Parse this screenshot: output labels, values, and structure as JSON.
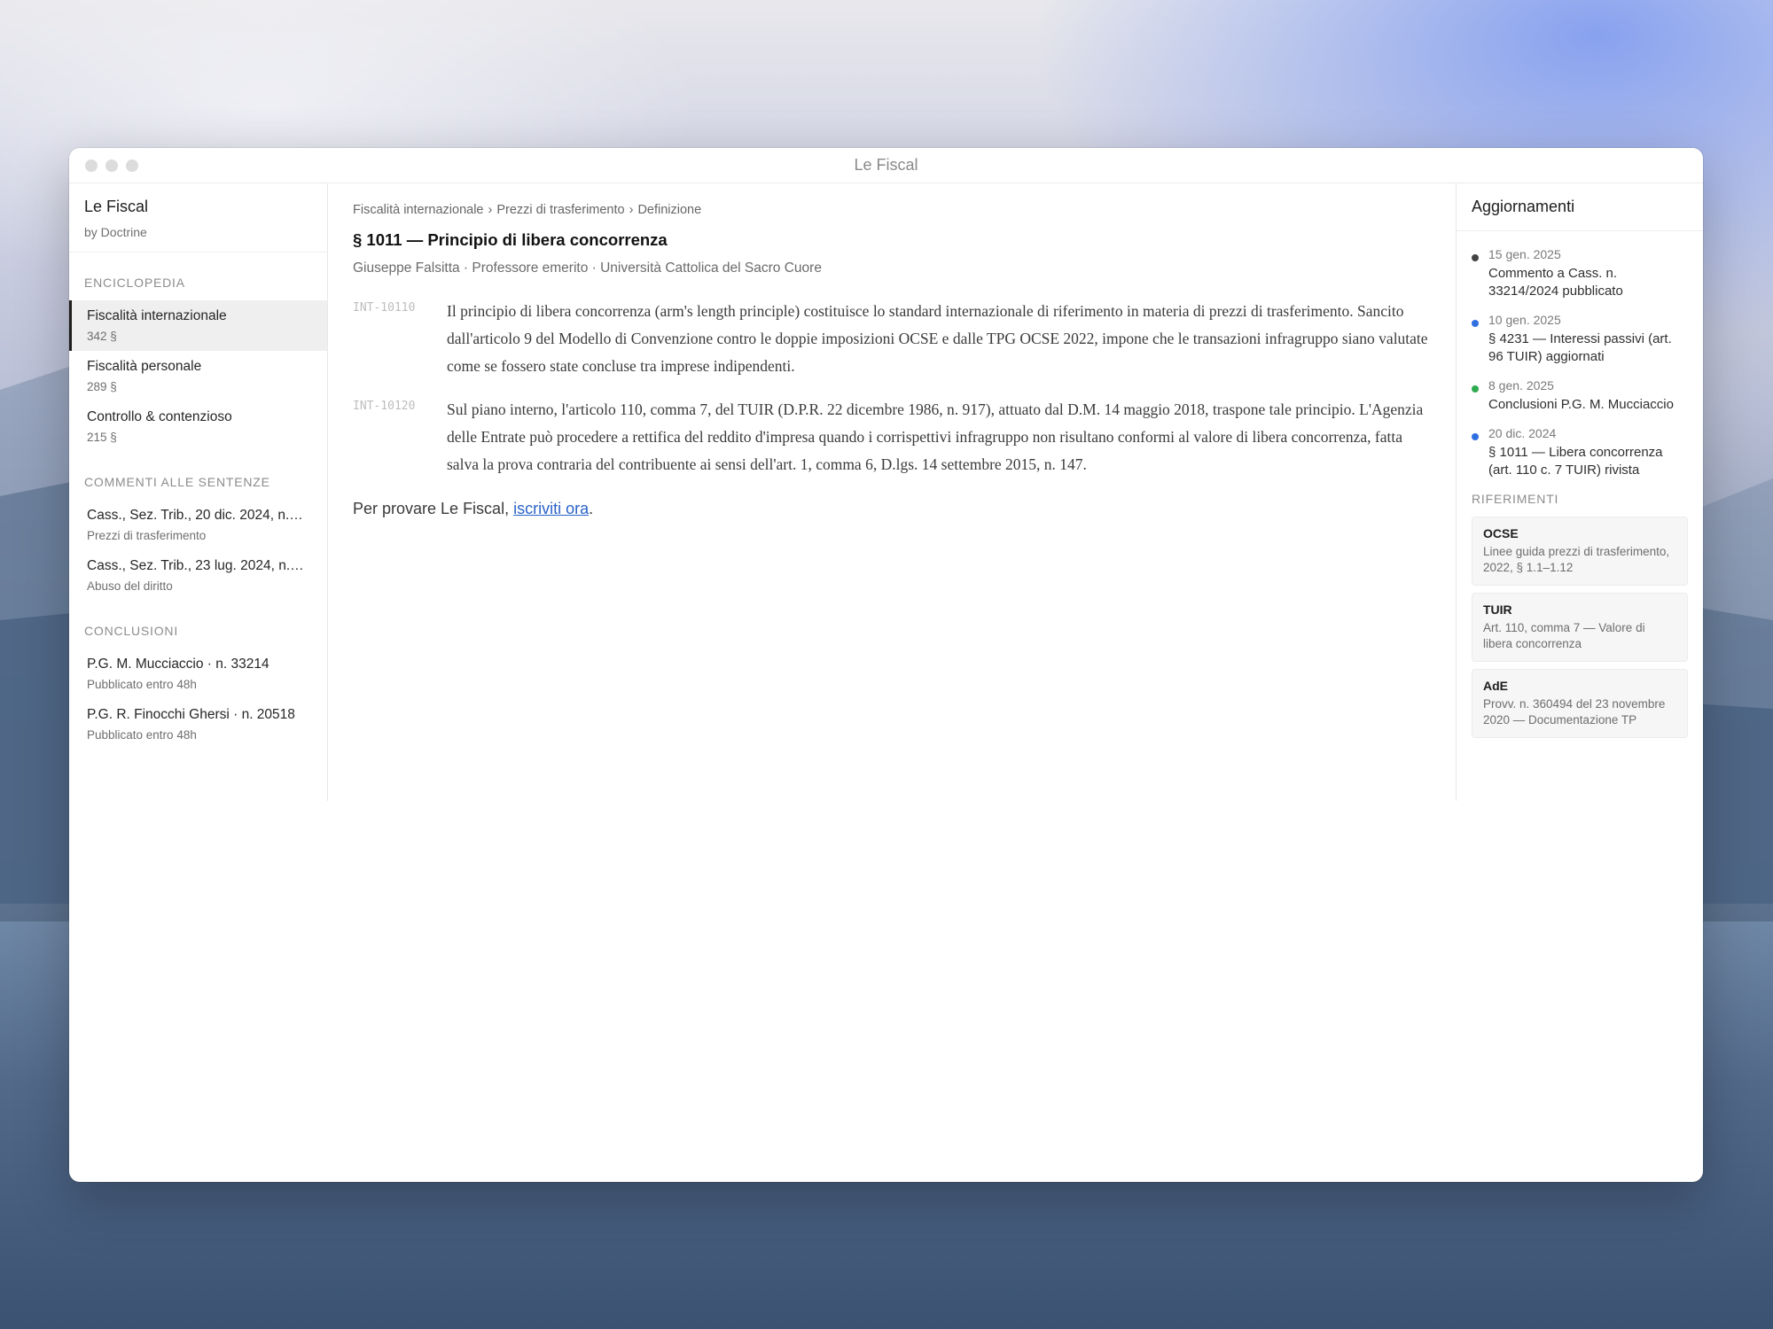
{
  "window": {
    "title": "Le Fiscal"
  },
  "sidebar": {
    "brand_title": "Le Fiscal",
    "brand_sub": "by Doctrine",
    "sections": [
      {
        "heading": "ENCICLOPEDIA",
        "items": [
          {
            "label": "Fiscalità internazionale",
            "meta": "342 §",
            "active": true
          },
          {
            "label": "Fiscalità personale",
            "meta": "289 §"
          },
          {
            "label": "Controllo & contenzioso",
            "meta": "215 §"
          }
        ]
      },
      {
        "heading": "COMMENTI ALLE SENTENZE",
        "items": [
          {
            "label": "Cass., Sez. Trib., 20 dic. 2024, n.…",
            "meta": "Prezzi di trasferimento"
          },
          {
            "label": "Cass., Sez. Trib., 23 lug. 2024, n.…",
            "meta": "Abuso del diritto"
          }
        ]
      },
      {
        "heading": "CONCLUSIONI",
        "items": [
          {
            "label": "P.G. M. Mucciaccio · n. 33214",
            "meta": "Pubblicato entro 48h"
          },
          {
            "label": "P.G. R. Finocchi Ghersi · n. 20518",
            "meta": "Pubblicato entro 48h"
          }
        ]
      }
    ]
  },
  "main": {
    "breadcrumb": [
      "Fiscalità internazionale",
      "Prezzi di trasferimento",
      "Definizione"
    ],
    "breadcrumb_sep": "›",
    "title": "§ 1011 — Principio di libera concorrenza",
    "author": "Giuseppe Falsitta · Professore emerito · Università Cattolica del Sacro Cuore",
    "paragraphs": [
      {
        "id": "INT-10110",
        "text": "Il principio di libera concorrenza (arm's length principle) costituisce lo standard internazionale di riferimento in materia di prezzi di trasferimento. Sancito dall'articolo 9 del Modello di Convenzione contro le doppie imposizioni OCSE e dalle TPG OCSE 2022, impone che le transazioni infragruppo siano valutate come se fossero state concluse tra imprese indipendenti."
      },
      {
        "id": "INT-10120",
        "text": "Sul piano interno, l'articolo 110, comma 7, del TUIR (D.P.R. 22 dicembre 1986, n. 917), attuato dal D.M. 14 maggio 2018, traspone tale principio. L'Agenzia delle Entrate può procedere a rettifica del reddito d'impresa quando i corrispettivi infragruppo non risultano conformi al valore di libera concorrenza, fatta salva la prova contraria del contribuente ai sensi dell'art. 1, comma 6, D.lgs. 14 settembre 2015, n. 147."
      }
    ],
    "cta_prefix": "Per provare Le Fiscal, ",
    "cta_link": "iscriviti ora",
    "cta_suffix": "."
  },
  "right": {
    "heading": "Aggiornamenti",
    "updates": [
      {
        "date": "15 gen. 2025",
        "text": "Commento a Cass. n. 33214/2024 pubblicato",
        "color": "#444444"
      },
      {
        "date": "10 gen. 2025",
        "text": "§ 4231 — Interessi passivi (art. 96 TUIR) aggiornati",
        "color": "#2f6fe0"
      },
      {
        "date": "8 gen. 2025",
        "text": "Conclusioni P.G. M. Mucciaccio",
        "color": "#2eaa4f"
      },
      {
        "date": "20 dic. 2024",
        "text": "§ 1011 — Libera concorrenza (art. 110 c. 7 TUIR) rivista",
        "color": "#2f6fe0"
      }
    ],
    "refs_heading": "RIFERIMENTI",
    "refs": [
      {
        "title": "OCSE",
        "text": "Linee guida prezzi di trasferimento, 2022, § 1.1–1.12"
      },
      {
        "title": "TUIR",
        "text": "Art. 110, comma 7 — Valore di libera concorrenza"
      },
      {
        "title": "AdE",
        "text": "Provv. n. 360494 del 23 novembre 2020 — Documentazione TP"
      }
    ]
  }
}
